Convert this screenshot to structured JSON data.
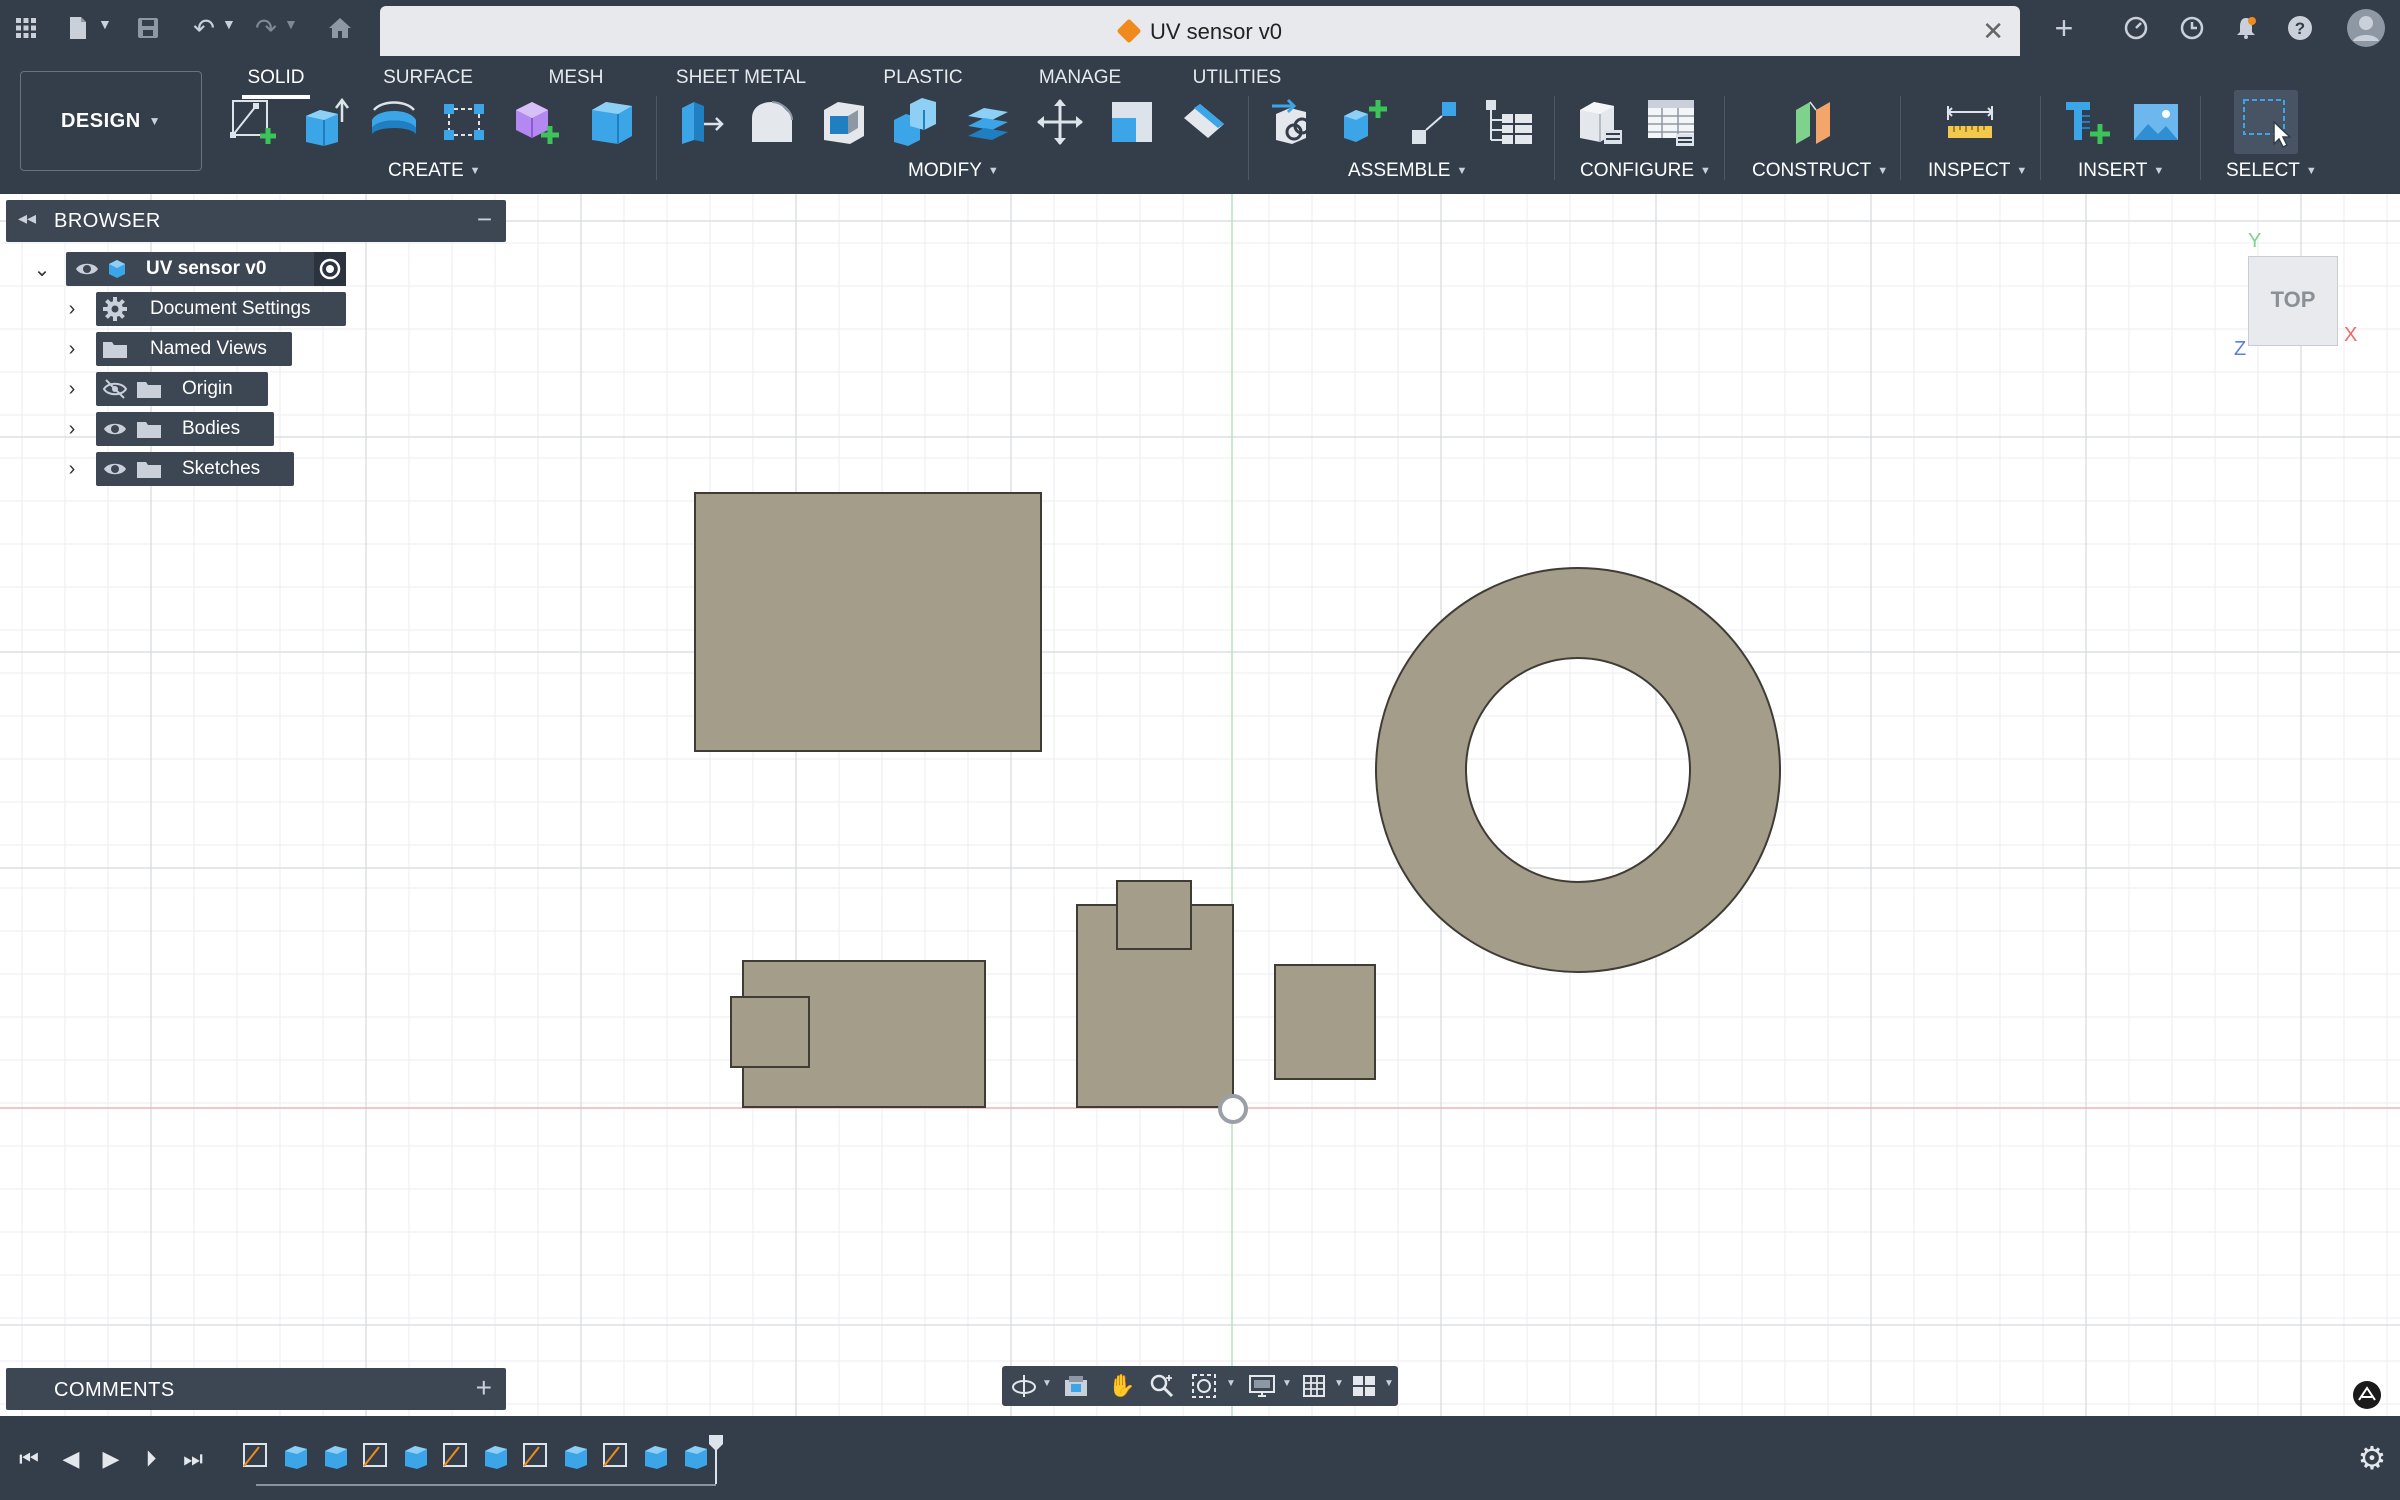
{
  "document": {
    "title": "UV sensor v0"
  },
  "titlebar": {
    "icons": [
      "apps-grid-icon",
      "file-icon",
      "save-icon",
      "undo-icon",
      "redo-icon",
      "home-icon",
      "close-icon",
      "new-tab-icon",
      "extensions-icon",
      "job-status-icon",
      "notifications-icon",
      "help-icon",
      "user-avatar"
    ]
  },
  "toolbar": {
    "workspace": "DESIGN",
    "tabs": [
      {
        "label": "SOLID"
      },
      {
        "label": "SURFACE"
      },
      {
        "label": "MESH"
      },
      {
        "label": "SHEET METAL"
      },
      {
        "label": "PLASTIC"
      },
      {
        "label": "MANAGE"
      },
      {
        "label": "UTILITIES"
      }
    ],
    "active_tab": "SOLID",
    "groups": [
      {
        "label": "CREATE"
      },
      {
        "label": "MODIFY"
      },
      {
        "label": "ASSEMBLE"
      },
      {
        "label": "CONFIGURE"
      },
      {
        "label": "CONSTRUCT"
      },
      {
        "label": "INSPECT"
      },
      {
        "label": "INSERT"
      },
      {
        "label": "SELECT"
      }
    ]
  },
  "browser": {
    "title": "BROWSER",
    "root": "UV sensor v0",
    "items": [
      {
        "label": "Document Settings",
        "visibility": "none"
      },
      {
        "label": "Named Views",
        "visibility": "none"
      },
      {
        "label": "Origin",
        "visibility": "hidden"
      },
      {
        "label": "Bodies",
        "visibility": "visible"
      },
      {
        "label": "Sketches",
        "visibility": "visible"
      }
    ]
  },
  "viewcube": {
    "face": "TOP",
    "axes": {
      "y": "Y",
      "x": "X",
      "z": "Z"
    }
  },
  "comments": {
    "title": "COMMENTS"
  },
  "colors": {
    "chrome": "#343e4b",
    "panel": "#3d4653",
    "sketch_fill": "#a39d8a",
    "accent_blue": "#3ba5e8",
    "axis_x": "#ee6a6a",
    "axis_y": "#7ed28c",
    "axis_z": "#5a7de6"
  }
}
